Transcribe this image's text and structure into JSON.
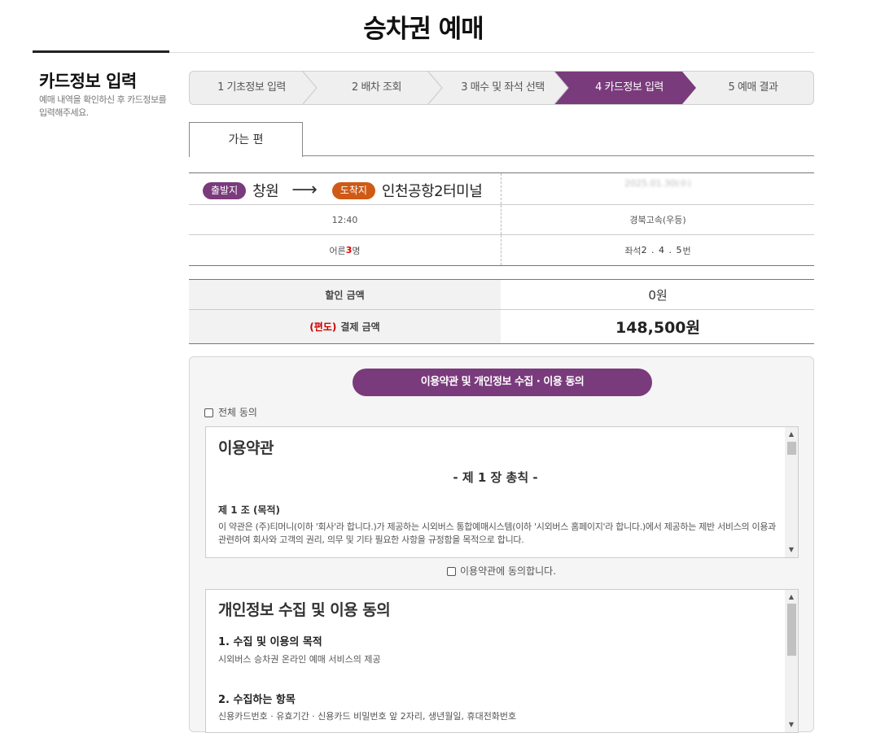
{
  "page": {
    "title": "승차권 예매"
  },
  "sidebar": {
    "title": "카드정보 입력",
    "desc": "예매 내역을 확인하신 후 카드정보를 입력해주세요."
  },
  "steps": [
    {
      "label": "1 기초정보 입력",
      "active": false
    },
    {
      "label": "2 배차 조회",
      "active": false
    },
    {
      "label": "3 매수 및 좌석 선택",
      "active": false
    },
    {
      "label": "4 카드정보 입력",
      "active": true
    },
    {
      "label": "5 예매 결과",
      "active": false
    }
  ],
  "colors": {
    "accent": "#7a3b7c",
    "arrival_badge": "#cf5a16",
    "price_red": "#dd0000"
  },
  "tab": {
    "label": "가는 편"
  },
  "trip": {
    "departure_badge": "출발지",
    "departure": "창원",
    "arrow": "⟶",
    "arrival_badge": "도착지",
    "arrival": "인천공항2터미널",
    "date": "2025.01.30(수)",
    "time": "12:40",
    "company": "경북고속(우등)",
    "passengers_prefix": "어른 ",
    "passengers_count": "3",
    "passengers_suffix": " 명",
    "seats_prefix": "좌석 ",
    "seats": "2 . 4 . 5",
    "seats_suffix": " 번"
  },
  "fare": {
    "discount_label": "할인 금액",
    "discount_value": "0원",
    "oneway_tag": "(편도)",
    "payment_label": "결제 금액",
    "payment_value": "148,500원"
  },
  "agreement": {
    "header": "이용약관 및 개인정보 수집 · 이용 동의",
    "all_agree": "전체 동의",
    "terms": {
      "title": "이용약관",
      "chapter": "- 제 1 장 총칙 -",
      "article_title": "제 1 조 (목적)",
      "article_body": "이 약관은 (주)티머니(이하 '회사'라 합니다.)가 제공하는 시외버스 통합예매시스템(이하 '시외버스 홈페이지'라 합니다.)에서 제공하는 제반 서비스의 이용과 관련하여 회사와 고객의 권리, 의무 및 기타 필요한 사항을 규정함을 목적으로 합니다."
    },
    "terms_agree": "이용약관에 동의합니다.",
    "privacy": {
      "title": "개인정보 수집 및 이용 동의",
      "section1_title": "1. 수집 및 이용의 목적",
      "section1_body": "시외버스 승차권 온라인 예매 서비스의 제공",
      "section2_title": "2. 수집하는 항목",
      "section2_body": "신용카드번호 · 유효기간 · 신용카드 비밀번호 앞 2자리, 생년월일, 휴대전화번호"
    },
    "scroll_up": "▲",
    "scroll_down": "▼"
  }
}
